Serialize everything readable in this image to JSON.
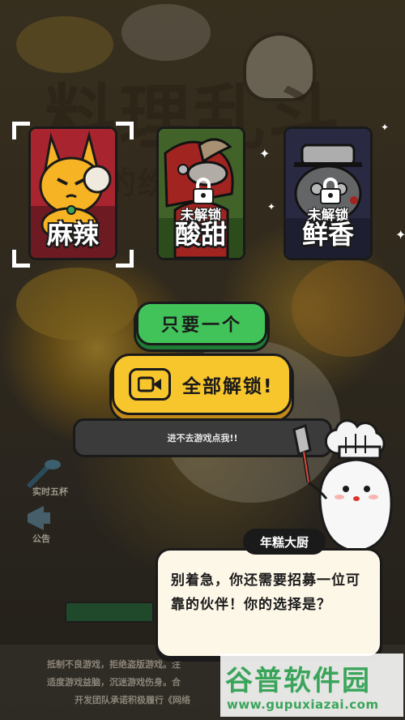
{
  "background": {
    "title": "料理乱斗",
    "subtitle": "的纷",
    "ghost_label": "Dumpling mascot"
  },
  "characters": [
    {
      "name": "麻辣",
      "locked": false,
      "selected": true,
      "color": "#f2a21c"
    },
    {
      "name": "酸甜",
      "locked": true,
      "selected": false,
      "lock_label": "未解锁",
      "color": "#5a8a3a"
    },
    {
      "name": "鲜香",
      "locked": true,
      "selected": false,
      "lock_label": "未解锁",
      "color": "#3a3b5c"
    }
  ],
  "buttons": {
    "pick_one": "只要一个",
    "unlock_all": "全部解锁!",
    "help": "进不去游戏点我!!"
  },
  "side": {
    "item_1": "实时五杯",
    "item_2": "公告"
  },
  "dialog": {
    "speaker": "年糕大厨",
    "text": "别着急，你还需要招募一位可靠的伙伴！你的选择是？"
  },
  "notice": {
    "line_1": "抵制不良游戏，拒绝盗版游戏。注",
    "line_2": "适度游戏益脑，沉迷游戏伤身。合",
    "line_3": "开发团队承诺积极履行《网络"
  },
  "watermark": {
    "brand": "谷普软件园",
    "url": "www.gupuxiazai.com"
  },
  "colors": {
    "green_button": "#42c35a",
    "yellow_button": "#f7c52c",
    "dialog_bg": "#fdf7e8"
  }
}
